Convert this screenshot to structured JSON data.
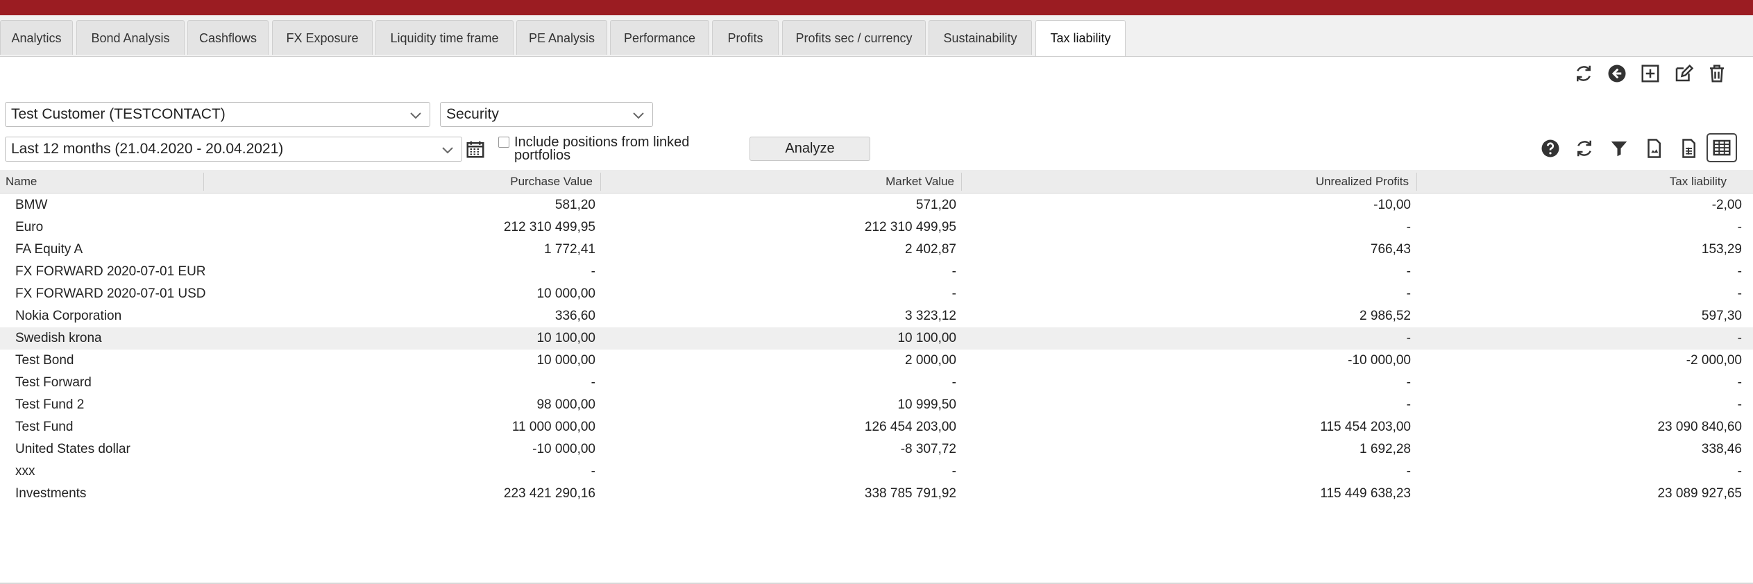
{
  "colors": {
    "topbar": "#9b1c22"
  },
  "tabs": [
    {
      "label": "Analytics"
    },
    {
      "label": "Bond Analysis"
    },
    {
      "label": "Cashflows"
    },
    {
      "label": "FX Exposure"
    },
    {
      "label": "Liquidity time frame"
    },
    {
      "label": "PE Analysis"
    },
    {
      "label": "Performance"
    },
    {
      "label": "Profits"
    },
    {
      "label": "Profits sec / currency"
    },
    {
      "label": "Sustainability"
    },
    {
      "label": "Tax liability"
    }
  ],
  "active_tab": "Tax liability",
  "toolbar_icons": [
    "refresh-icon",
    "back-arrow-icon",
    "add-icon",
    "edit-icon",
    "trash-icon"
  ],
  "filters": {
    "customer": "Test Customer (TESTCONTACT)",
    "grouping": "Security",
    "period": "Last 12 months (21.04.2020 - 20.04.2021)",
    "include_linked_label_line1": "Include positions from linked",
    "include_linked_label_line2": "portfolios",
    "include_linked_checked": false,
    "analyze_label": "Analyze"
  },
  "grid_tools": [
    "help-icon",
    "refresh-icon",
    "filter-icon",
    "pdf-export-icon",
    "excel-export-icon",
    "table-view-icon"
  ],
  "table": {
    "columns": [
      "Name",
      "Purchase Value",
      "Market Value",
      "Unrealized Profits",
      "Tax liability"
    ],
    "rows": [
      {
        "name": "BMW",
        "purchase": "581,20",
        "market": "571,20",
        "unrealized": "-10,00",
        "tax": "-2,00"
      },
      {
        "name": "Euro",
        "purchase": "212 310 499,95",
        "market": "212 310 499,95",
        "unrealized": "-",
        "tax": "-"
      },
      {
        "name": "FA Equity A",
        "purchase": "1 772,41",
        "market": "2 402,87",
        "unrealized": "766,43",
        "tax": "153,29"
      },
      {
        "name": "FX FORWARD 2020-07-01 EUR",
        "purchase": "-",
        "market": "-",
        "unrealized": "-",
        "tax": "-"
      },
      {
        "name": "FX FORWARD 2020-07-01 USD",
        "purchase": "10 000,00",
        "market": "-",
        "unrealized": "-",
        "tax": "-"
      },
      {
        "name": "Nokia Corporation",
        "purchase": "336,60",
        "market": "3 323,12",
        "unrealized": "2 986,52",
        "tax": "597,30"
      },
      {
        "name": "Swedish krona",
        "purchase": "10 100,00",
        "market": "10 100,00",
        "unrealized": "-",
        "tax": "-"
      },
      {
        "name": "Test Bond",
        "purchase": "10 000,00",
        "market": "2 000,00",
        "unrealized": "-10 000,00",
        "tax": "-2 000,00"
      },
      {
        "name": "Test Forward",
        "purchase": "-",
        "market": "-",
        "unrealized": "-",
        "tax": "-"
      },
      {
        "name": "Test Fund 2",
        "purchase": "98 000,00",
        "market": "10 999,50",
        "unrealized": "-",
        "tax": "-"
      },
      {
        "name": "Test Fund",
        "purchase": "11 000 000,00",
        "market": "126 454 203,00",
        "unrealized": "115 454 203,00",
        "tax": "23 090 840,60"
      },
      {
        "name": "United States dollar",
        "purchase": "-10 000,00",
        "market": "-8 307,72",
        "unrealized": "1 692,28",
        "tax": "338,46"
      },
      {
        "name": "xxx",
        "purchase": "-",
        "market": "-",
        "unrealized": "-",
        "tax": "-"
      },
      {
        "name": "Investments",
        "purchase": "223 421 290,16",
        "market": "338 785 791,92",
        "unrealized": "115 449 638,23",
        "tax": "23 089 927,65"
      }
    ]
  }
}
